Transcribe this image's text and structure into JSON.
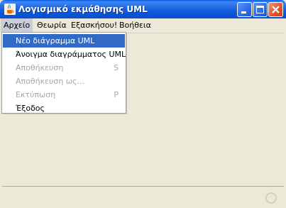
{
  "window": {
    "title": "Λογισμικό εκμάθησης UML",
    "buttons": {
      "minimize_icon": "minimize-icon",
      "maximize_icon": "maximize-icon",
      "close_icon": "close-icon"
    },
    "app_icon": "java-cup-icon"
  },
  "menubar": {
    "items": [
      {
        "label": "Αρχείο",
        "active": true
      },
      {
        "label": "Θεωρία",
        "active": false
      },
      {
        "label": "Εξασκήσου!",
        "active": false
      },
      {
        "label": "Βοήθεια",
        "active": false
      }
    ]
  },
  "file_menu": {
    "items": [
      {
        "label": "Νέο διάγραμμα UML",
        "shortcut": "",
        "enabled": true,
        "selected": true
      },
      {
        "label": "Άνοιγμα διαγράμματος UML",
        "shortcut": "",
        "enabled": true,
        "selected": false
      },
      {
        "label": "Αποθήκευση",
        "shortcut": "S",
        "enabled": false,
        "selected": false
      },
      {
        "label": "Αποθήκευση ως...",
        "shortcut": "",
        "enabled": false,
        "selected": false
      },
      {
        "label": "Εκτύπωση",
        "shortcut": "P",
        "enabled": false,
        "selected": false
      },
      {
        "label": "Έξοδος",
        "shortcut": "",
        "enabled": true,
        "selected": false
      }
    ]
  },
  "colors": {
    "titlebar": "#0A54D6",
    "selection": "#316AC5",
    "disabled_text": "#A7A6AA",
    "background": "#ECE9D8"
  }
}
